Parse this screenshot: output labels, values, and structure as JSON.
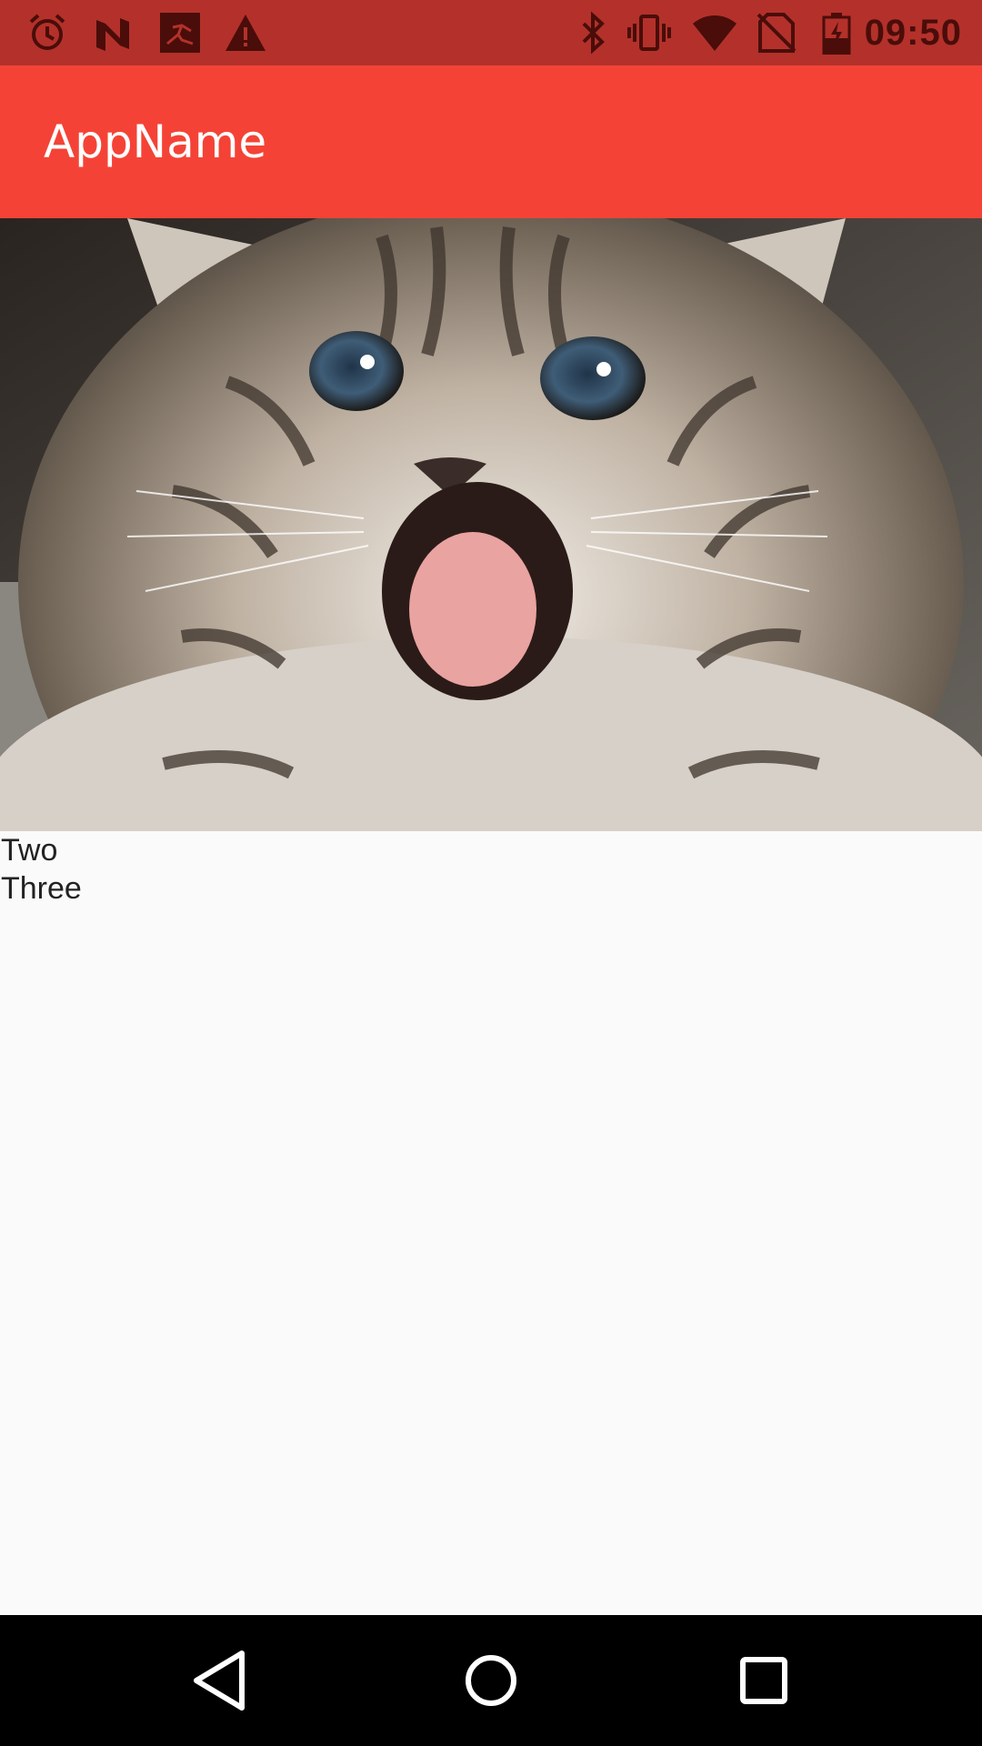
{
  "status_bar": {
    "time": "09:50",
    "left_icons": [
      "alarm-icon",
      "n-notification-icon",
      "fitness-app-icon",
      "warning-icon"
    ],
    "right_icons": [
      "bluetooth-icon",
      "vibrate-icon",
      "wifi-icon",
      "no-sim-icon",
      "battery-charging-icon"
    ],
    "background_color": "#b3312a"
  },
  "app_bar": {
    "title": "AppName",
    "background_color": "#f44336"
  },
  "content": {
    "image": "kitten-photo",
    "items": [
      {
        "label": "Two"
      },
      {
        "label": "Three"
      }
    ]
  },
  "nav_bar": {
    "buttons": [
      "back-icon",
      "home-icon",
      "recents-icon"
    ],
    "background_color": "#000000"
  }
}
